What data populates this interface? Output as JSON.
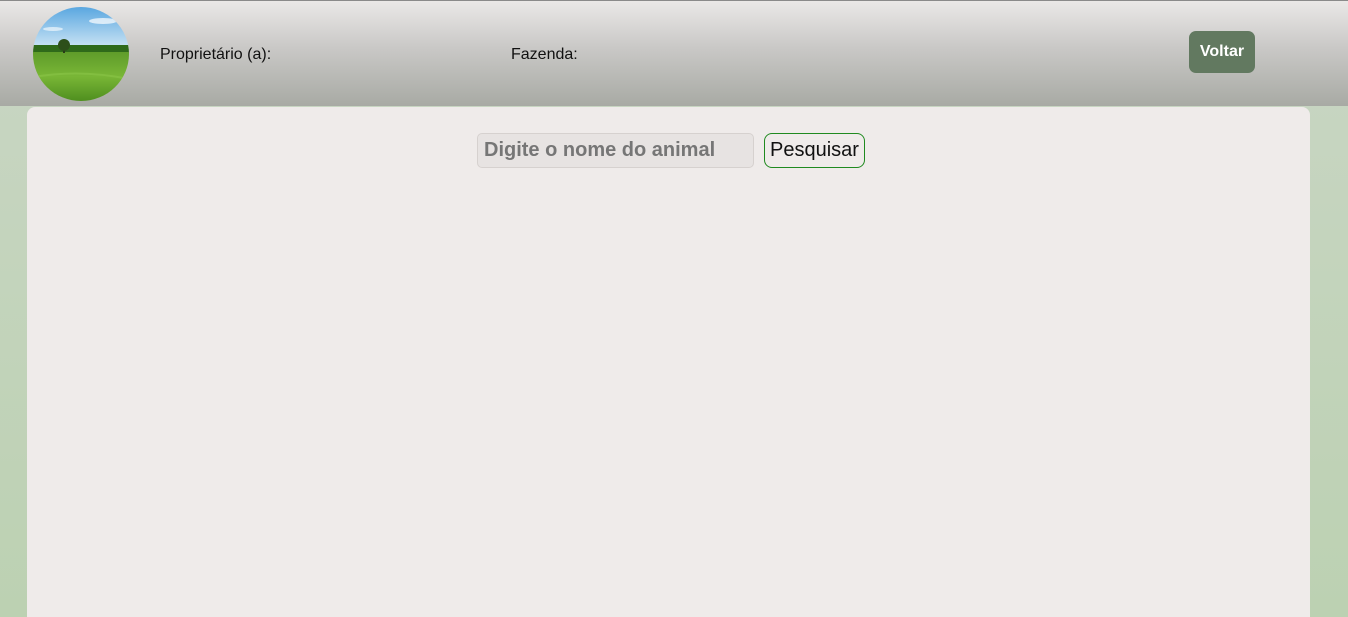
{
  "header": {
    "avatar_icon": "farm-landscape-image",
    "owner_label": "Proprietário (a):",
    "farm_label": "Fazenda:",
    "back_button_label": "Voltar"
  },
  "search": {
    "placeholder": "Digite o nome do animal",
    "value": "",
    "button_label": "Pesquisar"
  },
  "colors": {
    "header_gradient_top": "#eae8e7",
    "header_gradient_bottom": "#a8aaa4",
    "back_button_bg": "#627960",
    "panel_bg": "#efebea",
    "page_bg": "#bcd1b2",
    "search_button_border": "#1f8a1f"
  }
}
